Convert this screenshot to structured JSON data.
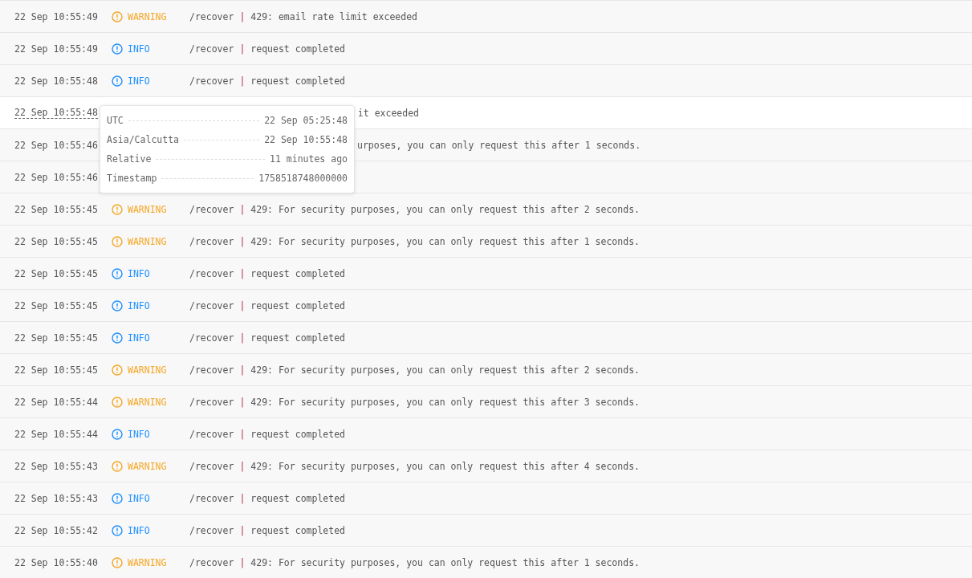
{
  "rows": [
    {
      "time": "22 Sep 10:55:49",
      "kind": "warning",
      "label": "WARNING",
      "path": "/recover",
      "separator": "|",
      "message": "429: email rate limit exceeded",
      "hovered": false
    },
    {
      "time": "22 Sep 10:55:49",
      "kind": "info",
      "label": "INFO",
      "path": "/recover",
      "separator": "|",
      "message": "request completed",
      "hovered": false
    },
    {
      "time": "22 Sep 10:55:48",
      "kind": "info",
      "label": "INFO",
      "path": "/recover",
      "separator": "|",
      "message": "request completed",
      "hovered": false
    },
    {
      "time": "22 Sep 10:55:48",
      "kind": "covered",
      "tail": "it exceeded",
      "hovered": true
    },
    {
      "time": "22 Sep 10:55:46",
      "kind": "covered",
      "tail": "urposes, you can only request this after 1 seconds.",
      "hovered": false
    },
    {
      "time": "22 Sep 10:55:46",
      "kind": "covered",
      "hovered": false
    },
    {
      "time": "22 Sep 10:55:45",
      "kind": "warning",
      "label": "WARNING",
      "path": "/recover",
      "separator": "|",
      "message": "429: For security purposes, you can only request this after 2 seconds.",
      "hovered": false
    },
    {
      "time": "22 Sep 10:55:45",
      "kind": "warning",
      "label": "WARNING",
      "path": "/recover",
      "separator": "|",
      "message": "429: For security purposes, you can only request this after 1 seconds.",
      "hovered": false
    },
    {
      "time": "22 Sep 10:55:45",
      "kind": "info",
      "label": "INFO",
      "path": "/recover",
      "separator": "|",
      "message": "request completed",
      "hovered": false
    },
    {
      "time": "22 Sep 10:55:45",
      "kind": "info",
      "label": "INFO",
      "path": "/recover",
      "separator": "|",
      "message": "request completed",
      "hovered": false
    },
    {
      "time": "22 Sep 10:55:45",
      "kind": "info",
      "label": "INFO",
      "path": "/recover",
      "separator": "|",
      "message": "request completed",
      "hovered": false
    },
    {
      "time": "22 Sep 10:55:45",
      "kind": "warning",
      "label": "WARNING",
      "path": "/recover",
      "separator": "|",
      "message": "429: For security purposes, you can only request this after 2 seconds.",
      "hovered": false
    },
    {
      "time": "22 Sep 10:55:44",
      "kind": "warning",
      "label": "WARNING",
      "path": "/recover",
      "separator": "|",
      "message": "429: For security purposes, you can only request this after 3 seconds.",
      "hovered": false
    },
    {
      "time": "22 Sep 10:55:44",
      "kind": "info",
      "label": "INFO",
      "path": "/recover",
      "separator": "|",
      "message": "request completed",
      "hovered": false
    },
    {
      "time": "22 Sep 10:55:43",
      "kind": "warning",
      "label": "WARNING",
      "path": "/recover",
      "separator": "|",
      "message": "429: For security purposes, you can only request this after 4 seconds.",
      "hovered": false
    },
    {
      "time": "22 Sep 10:55:43",
      "kind": "info",
      "label": "INFO",
      "path": "/recover",
      "separator": "|",
      "message": "request completed",
      "hovered": false
    },
    {
      "time": "22 Sep 10:55:42",
      "kind": "info",
      "label": "INFO",
      "path": "/recover",
      "separator": "|",
      "message": "request completed",
      "hovered": false
    },
    {
      "time": "22 Sep 10:55:40",
      "kind": "warning",
      "label": "WARNING",
      "path": "/recover",
      "separator": "|",
      "message": "429: For security purposes, you can only request this after 1 seconds.",
      "hovered": false
    }
  ],
  "tooltip": {
    "entries": [
      {
        "label": "UTC",
        "value": "22 Sep 05:25:48"
      },
      {
        "label": "Asia/Calcutta",
        "value": "22 Sep 10:55:48"
      },
      {
        "label": "Relative",
        "value": "11 minutes ago"
      },
      {
        "label": "Timestamp",
        "value": "1758518748000000"
      }
    ]
  }
}
